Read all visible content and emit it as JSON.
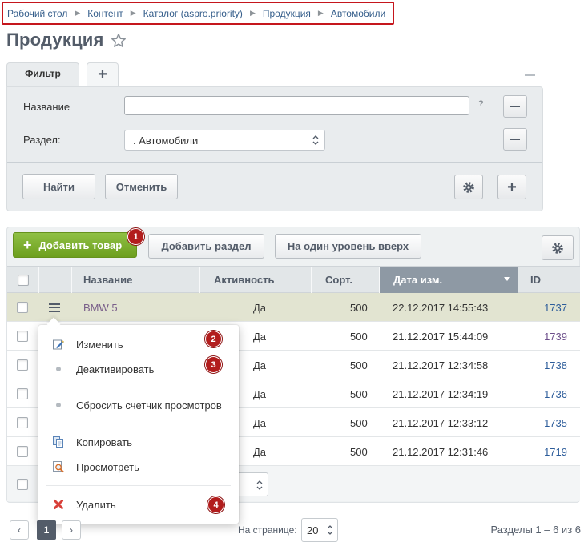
{
  "breadcrumb": [
    "Рабочий стол",
    "Контент",
    "Каталог (aspro.priority)",
    "Продукция",
    "Автомобили"
  ],
  "page_title": "Продукция",
  "filter": {
    "tab_label": "Фильтр",
    "name_label": "Название",
    "name_value": "",
    "help": "?",
    "section_label": "Раздел:",
    "section_value": ". Автомобили",
    "find_button": "Найти",
    "cancel_button": "Отменить"
  },
  "toolbar": {
    "add_product": "Добавить товар",
    "add_section": "Добавить раздел",
    "level_up": "На один уровень вверх"
  },
  "table": {
    "columns": [
      "Название",
      "Активность",
      "Сорт.",
      "Дата изм.",
      "ID"
    ],
    "rows": [
      {
        "name": "BMW 5",
        "active": "Да",
        "sort": "500",
        "date": "22.12.2017 14:55:43",
        "id": "1737"
      },
      {
        "name": "",
        "active": "Да",
        "sort": "500",
        "date": "21.12.2017 15:44:09",
        "id": "1739"
      },
      {
        "name": "",
        "active": "Да",
        "sort": "500",
        "date": "21.12.2017 12:34:58",
        "id": "1738"
      },
      {
        "name": "",
        "active": "Да",
        "sort": "500",
        "date": "21.12.2017 12:34:19",
        "id": "1736"
      },
      {
        "name": "",
        "active": "Да",
        "sort": "500",
        "date": "21.12.2017 12:33:12",
        "id": "1735"
      },
      {
        "name": "",
        "active": "Да",
        "sort": "500",
        "date": "21.12.2017 12:31:46",
        "id": "1719"
      }
    ]
  },
  "context_menu": {
    "edit": "Изменить",
    "deactivate": "Деактивировать",
    "reset_counter": "Сбросить счетчик просмотров",
    "copy": "Копировать",
    "view": "Просмотреть",
    "delete": "Удалить"
  },
  "badges": [
    "1",
    "2",
    "3",
    "4"
  ],
  "pagination": {
    "current_page": "1",
    "per_page_label": "На странице:",
    "per_page_value": "20",
    "info": "Разделы 1 – 6 из 6"
  },
  "colors": {
    "accent_green": "#7bae2f",
    "badge_red": "#b21d1d",
    "breadcrumb_border": "#c5161d",
    "highlight_row": "#e2e4d1",
    "sorted_header": "#8e99a4"
  }
}
